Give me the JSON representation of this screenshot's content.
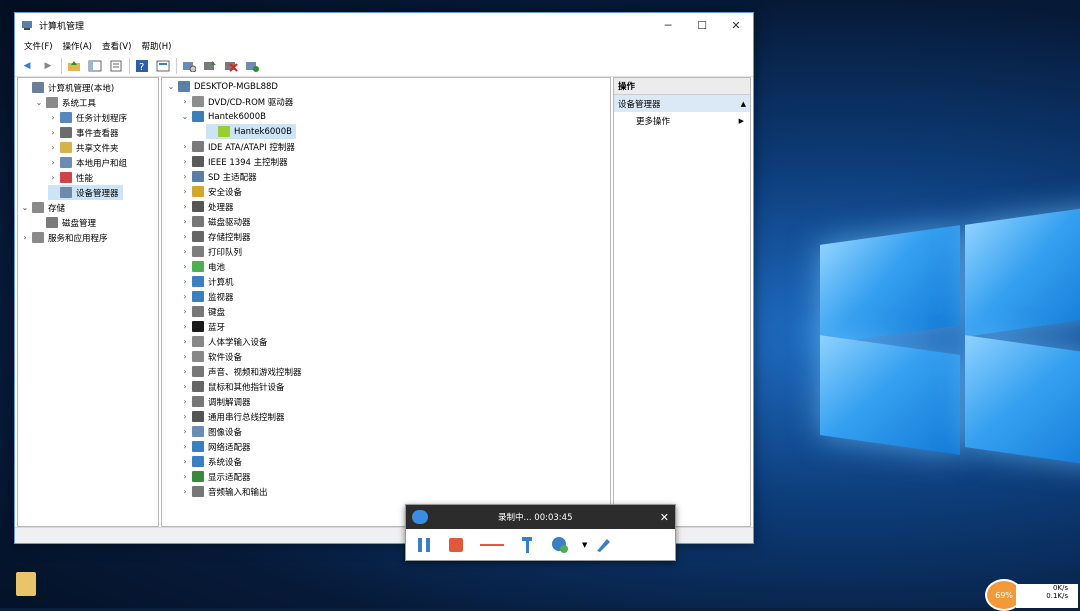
{
  "window": {
    "title": "计算机管理",
    "controls": {
      "minimize": "─",
      "maximize": "☐",
      "close": "✕"
    }
  },
  "menu": [
    "文件(F)",
    "操作(A)",
    "查看(V)",
    "帮助(H)"
  ],
  "left_tree": [
    {
      "label": "计算机管理(本地)",
      "level": 0,
      "expander": "",
      "icon_color": "#6a7f99"
    },
    {
      "label": "系统工具",
      "level": 1,
      "expander": "⌄",
      "icon_color": "#8a8a8a"
    },
    {
      "label": "任务计划程序",
      "level": 2,
      "expander": "›",
      "icon_color": "#5a86b8"
    },
    {
      "label": "事件查看器",
      "level": 2,
      "expander": "›",
      "icon_color": "#6c6c6c"
    },
    {
      "label": "共享文件夹",
      "level": 2,
      "expander": "›",
      "icon_color": "#d6b24a"
    },
    {
      "label": "本地用户和组",
      "level": 2,
      "expander": "›",
      "icon_color": "#6a8cb5"
    },
    {
      "label": "性能",
      "level": 2,
      "expander": "›",
      "icon_color": "#c44"
    },
    {
      "label": "设备管理器",
      "level": 2,
      "expander": "",
      "icon_color": "#6f8aa8",
      "selected": true
    },
    {
      "label": "存储",
      "level": 0,
      "expander": "⌄",
      "icon_color": "#8a8a8a"
    },
    {
      "label": "磁盘管理",
      "level": 1,
      "expander": "",
      "icon_color": "#7a7a7a"
    },
    {
      "label": "服务和应用程序",
      "level": 0,
      "expander": "›",
      "icon_color": "#8a8a8a"
    }
  ],
  "device_tree": {
    "root": "DESKTOP-MGBL88D",
    "items": [
      {
        "label": "DVD/CD-ROM 驱动器",
        "expander": "›",
        "icon_color": "#8d8d8d"
      },
      {
        "label": "Hantek6000B",
        "expander": "⌄",
        "icon_color": "#3b7fb8"
      },
      {
        "label": "Hantek6000B",
        "expander": "",
        "icon_color": "#9acd32",
        "child": true,
        "highlight": true
      },
      {
        "label": "IDE ATA/ATAPI 控制器",
        "expander": "›",
        "icon_color": "#7a7a7a"
      },
      {
        "label": "IEEE 1394 主控制器",
        "expander": "›",
        "icon_color": "#5a5a5a"
      },
      {
        "label": "SD 主适配器",
        "expander": "›",
        "icon_color": "#5b7ea3"
      },
      {
        "label": "安全设备",
        "expander": "›",
        "icon_color": "#d4a630"
      },
      {
        "label": "处理器",
        "expander": "›",
        "icon_color": "#555"
      },
      {
        "label": "磁盘驱动器",
        "expander": "›",
        "icon_color": "#777"
      },
      {
        "label": "存储控制器",
        "expander": "›",
        "icon_color": "#666"
      },
      {
        "label": "打印队列",
        "expander": "›",
        "icon_color": "#7d7d7d"
      },
      {
        "label": "电池",
        "expander": "›",
        "icon_color": "#4caf50"
      },
      {
        "label": "计算机",
        "expander": "›",
        "icon_color": "#3a7fc2"
      },
      {
        "label": "监视器",
        "expander": "›",
        "icon_color": "#3a7fc2"
      },
      {
        "label": "键盘",
        "expander": "›",
        "icon_color": "#777"
      },
      {
        "label": "蓝牙",
        "expander": "›",
        "icon_color": "#1a1a1a"
      },
      {
        "label": "人体学输入设备",
        "expander": "›",
        "icon_color": "#888"
      },
      {
        "label": "软件设备",
        "expander": "›",
        "icon_color": "#888"
      },
      {
        "label": "声音、视频和游戏控制器",
        "expander": "›",
        "icon_color": "#777"
      },
      {
        "label": "鼠标和其他指针设备",
        "expander": "›",
        "icon_color": "#666"
      },
      {
        "label": "调制解调器",
        "expander": "›",
        "icon_color": "#777"
      },
      {
        "label": "通用串行总线控制器",
        "expander": "›",
        "icon_color": "#555"
      },
      {
        "label": "图像设备",
        "expander": "›",
        "icon_color": "#6a8cb5"
      },
      {
        "label": "网络适配器",
        "expander": "›",
        "icon_color": "#3a7fc2"
      },
      {
        "label": "系统设备",
        "expander": "›",
        "icon_color": "#3a7fc2"
      },
      {
        "label": "显示适配器",
        "expander": "›",
        "icon_color": "#3b8a3b"
      },
      {
        "label": "音频输入和输出",
        "expander": "›",
        "icon_color": "#777"
      }
    ]
  },
  "actions": {
    "header": "操作",
    "section": "设备管理器",
    "more": "更多操作"
  },
  "recorder": {
    "status": "录制中... 00:03:45",
    "close": "✕"
  },
  "tray": {
    "gauge": "69%",
    "up": "0K/s",
    "down": "0.1K/s"
  }
}
